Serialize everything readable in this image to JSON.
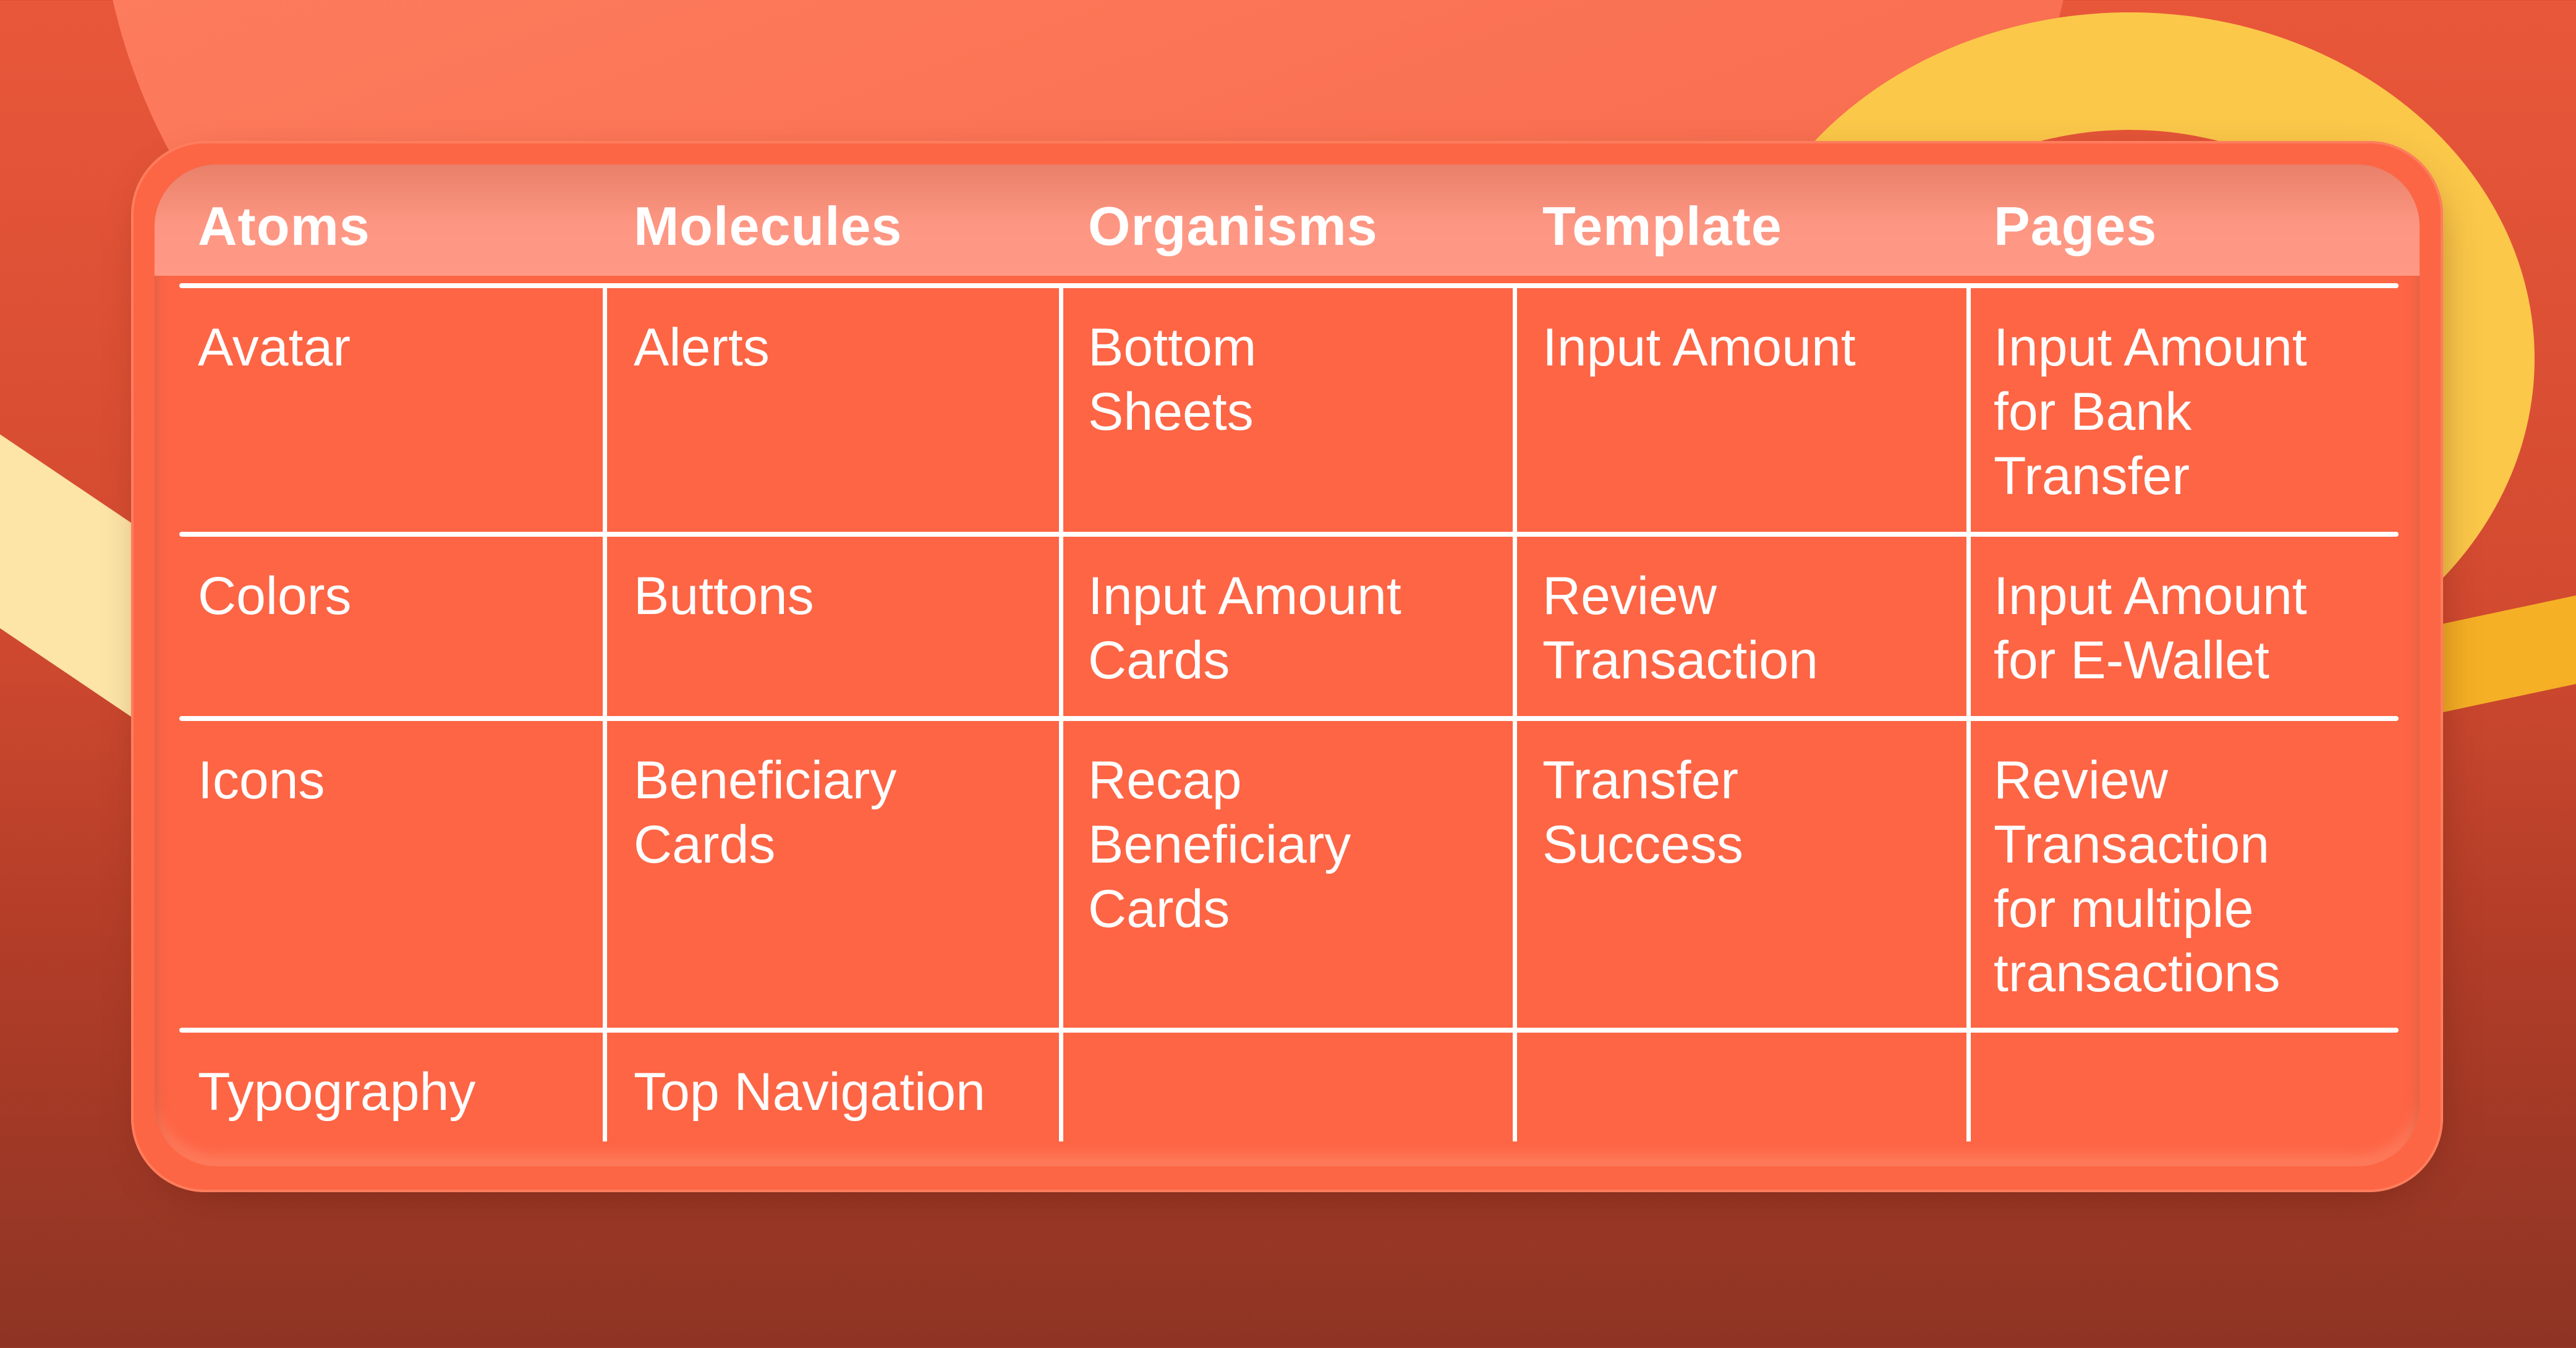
{
  "table": {
    "headers": [
      "Atoms",
      "Molecules",
      "Organisms",
      "Template",
      "Pages"
    ],
    "rows": [
      [
        [
          "Avatar"
        ],
        [
          "Alerts"
        ],
        [
          "Bottom",
          "Sheets"
        ],
        [
          "Input Amount"
        ],
        [
          "Input Amount",
          "for Bank",
          "Transfer"
        ]
      ],
      [
        [
          "Colors"
        ],
        [
          "Buttons"
        ],
        [
          "Input Amount",
          "Cards"
        ],
        [
          "Review",
          "Transaction"
        ],
        [
          "Input Amount",
          "for E-Wallet"
        ]
      ],
      [
        [
          "Icons"
        ],
        [
          "Beneficiary",
          "Cards"
        ],
        [
          "Recap",
          "Beneficiary",
          "Cards"
        ],
        [
          "Transfer",
          "Success"
        ],
        [
          "Review",
          "Transaction",
          "for multiple",
          "transactions"
        ]
      ],
      [
        [
          "Typography"
        ],
        [
          "Top Navigation"
        ],
        [],
        [],
        []
      ]
    ]
  },
  "colors": {
    "card": "#fd6545",
    "header_band": "#ff9985",
    "text": "#ffffff",
    "ring": "#fbc84a",
    "ribbon": "#fce5a6",
    "background_bottom": "#8e3424"
  }
}
